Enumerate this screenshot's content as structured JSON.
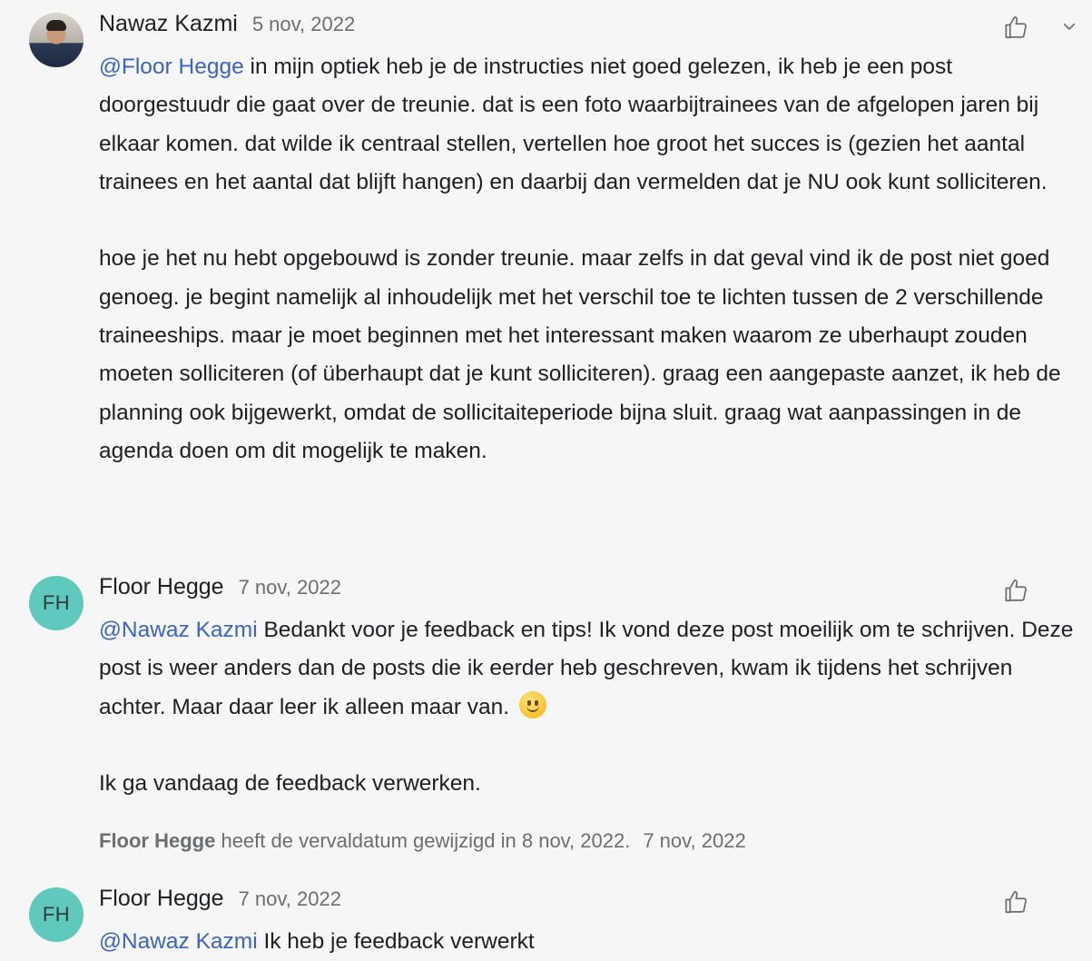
{
  "comments": [
    {
      "author": "Nawaz Kazmi",
      "date": "5 nov, 2022",
      "avatar_icon": "user-photo",
      "paragraphs": [
        {
          "mention": "@Floor Hegge",
          "text": " in mijn optiek heb je de instructies niet goed gelezen, ik heb je een post doorgestuudr die gaat over de treunie. dat is een foto waarbijtrainees van de afgelopen jaren bij elkaar komen. dat wilde ik centraal stellen, vertellen hoe groot het succes is (gezien het aantal trainees en het aantal dat blijft hangen) en daarbij dan vermelden dat je NU ook kunt solliciteren."
        },
        {
          "text": "hoe je het nu hebt opgebouwd is zonder treunie. maar zelfs in dat geval vind ik de post niet goed genoeg. je begint namelijk al inhoudelijk met het verschil toe te lichten tussen de 2 verschillende traineeships. maar je moet beginnen met het interessant maken waarom ze uberhaupt zouden moeten solliciteren (of überhaupt dat je kunt solliciteren). graag een aangepaste aanzet, ik heb de planning ook bijgewerkt, omdat de sollicitaiteperiode bijna sluit. graag wat aanpassingen in de agenda doen om dit mogelijk te maken."
        }
      ]
    },
    {
      "author": "Floor Hegge",
      "initials": "FH",
      "date": "7 nov, 2022",
      "paragraphs": [
        {
          "mention": "@Nawaz Kazmi",
          "text": " Bedankt voor je feedback en tips! Ik vond deze post moeilijk om te schrijven. Deze post is weer anders dan de posts die ik eerder heb geschreven, kwam ik tijdens het schrijven achter. Maar daar leer ik alleen maar van.",
          "emoji": "slightly-smiling-face"
        },
        {
          "text": "Ik ga vandaag de feedback verwerken."
        }
      ]
    },
    {
      "author": "Floor Hegge",
      "initials": "FH",
      "date": "7 nov, 2022",
      "paragraphs": [
        {
          "mention": "@Nawaz Kazmi",
          "text": " Ik heb je feedback verwerkt"
        }
      ]
    }
  ],
  "activity": {
    "who": "Floor Hegge",
    "action": " heeft de vervaldatum gewijzigd in 8 nov, 2022.",
    "when": "7 nov, 2022"
  },
  "colors": {
    "background": "#f6f6f6",
    "mention": "#3b63c9",
    "avatar_initials_bg": "#5fc9bd",
    "muted_text": "#6d6e6f"
  },
  "icons": {
    "like": "thumbs-up-icon",
    "menu": "chevron-down-icon"
  }
}
